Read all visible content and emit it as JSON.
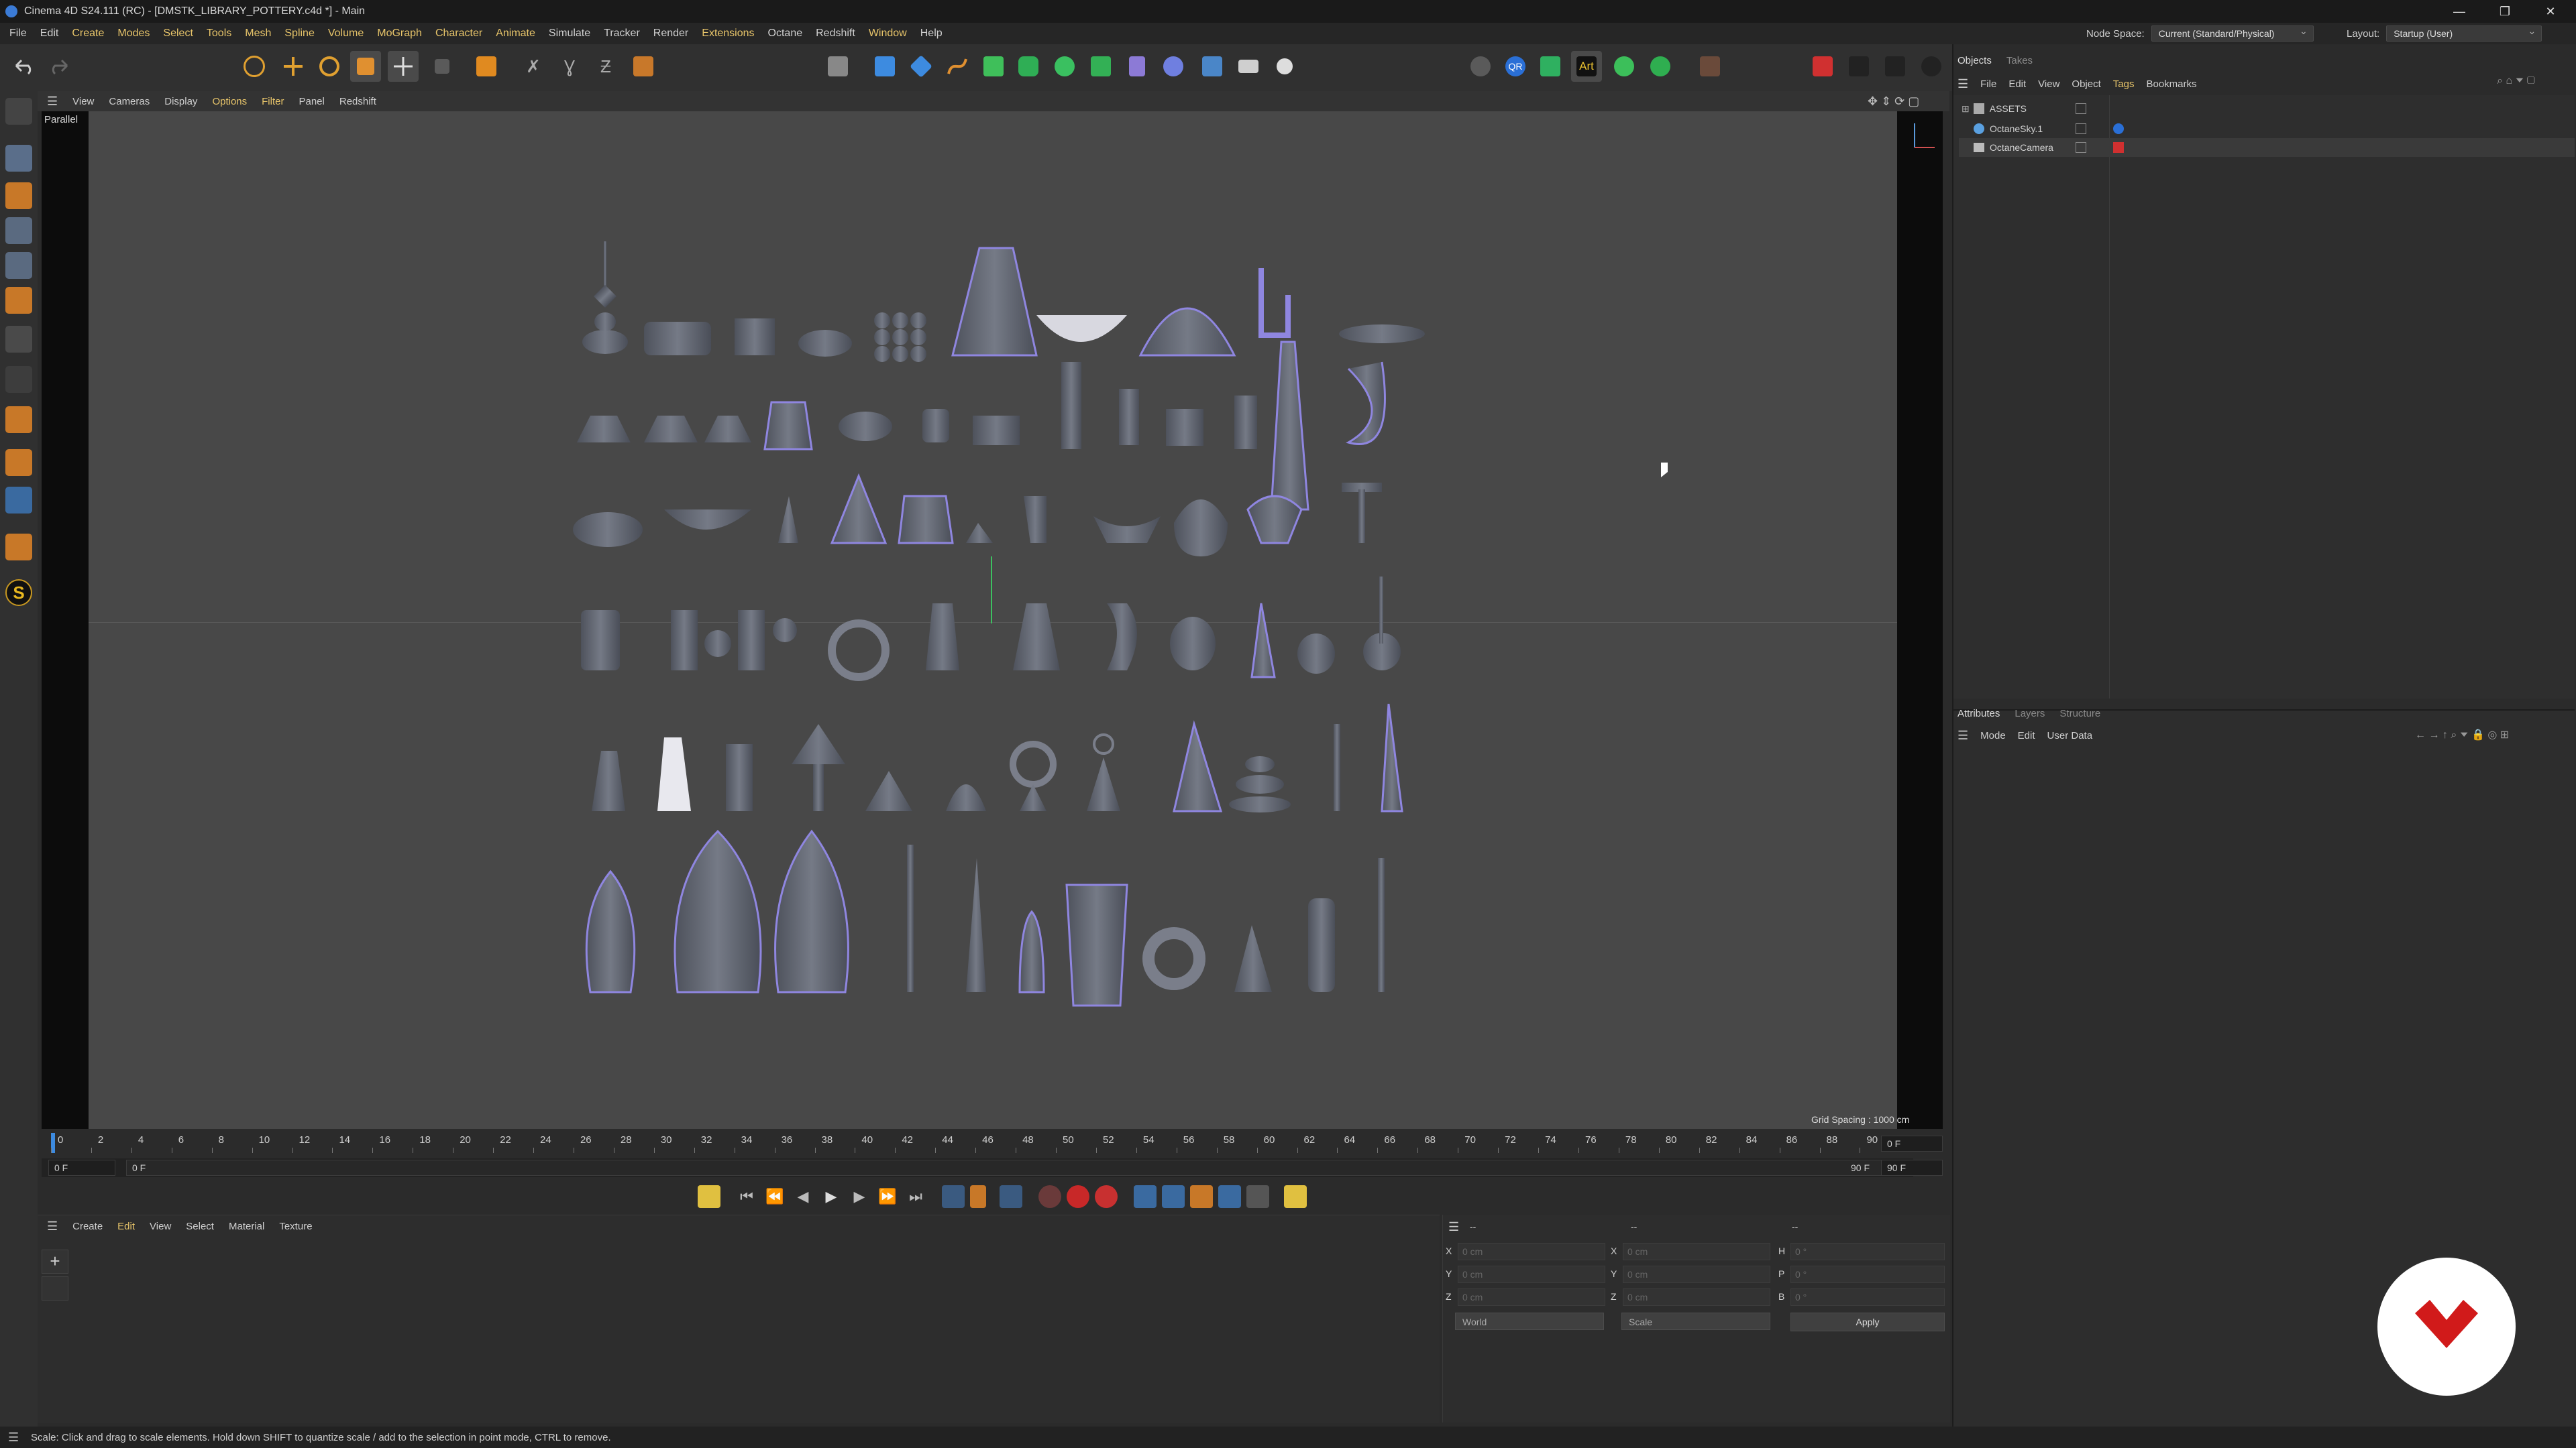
{
  "window": {
    "title": "Cinema 4D S24.111 (RC) - [DMSTK_LIBRARY_POTTERY.c4d *] - Main",
    "min": "—",
    "max": "❐",
    "close": "✕"
  },
  "menu": {
    "items": [
      "File",
      "Edit",
      "Create",
      "Modes",
      "Select",
      "Tools",
      "Mesh",
      "Spline",
      "Volume",
      "MoGraph",
      "Character",
      "Animate",
      "Simulate",
      "Tracker",
      "Render",
      "Extensions",
      "Octane",
      "Redshift",
      "Window",
      "Help"
    ],
    "node_space_label": "Node Space:",
    "node_space_value": "Current (Standard/Physical)",
    "layout_label": "Layout:",
    "layout_value": "Startup (User)"
  },
  "viewport": {
    "menu": [
      "View",
      "Cameras",
      "Display",
      "Options",
      "Filter",
      "Panel",
      "Redshift"
    ],
    "projection": "Parallel",
    "grid_spacing": "Grid Spacing : 1000 cm"
  },
  "timeline": {
    "ticks": [
      "0",
      "2",
      "4",
      "6",
      "8",
      "10",
      "12",
      "14",
      "16",
      "18",
      "20",
      "22",
      "24",
      "26",
      "28",
      "30",
      "32",
      "34",
      "36",
      "38",
      "40",
      "42",
      "44",
      "46",
      "48",
      "50",
      "52",
      "54",
      "56",
      "58",
      "60",
      "62",
      "64",
      "66",
      "68",
      "70",
      "72",
      "74",
      "76",
      "78",
      "80",
      "82",
      "84",
      "86",
      "88",
      "90"
    ],
    "current_frame": "0 F",
    "start_frame": "0 F",
    "start_inner": "0 F",
    "end_inner": "90 F",
    "end_frame": "90 F"
  },
  "material_manager": {
    "menu": [
      "Create",
      "Edit",
      "View",
      "Select",
      "Material",
      "Texture"
    ]
  },
  "coordinates": {
    "headers": [
      "--",
      "--",
      "--"
    ],
    "rows": [
      {
        "a": "X",
        "av": "0 cm",
        "b": "X",
        "bv": "0 cm",
        "c": "H",
        "cv": "0 °"
      },
      {
        "a": "Y",
        "av": "0 cm",
        "b": "Y",
        "bv": "0 cm",
        "c": "P",
        "cv": "0 °"
      },
      {
        "a": "Z",
        "av": "0 cm",
        "b": "Z",
        "bv": "0 cm",
        "c": "B",
        "cv": "0 °"
      }
    ],
    "space": "World",
    "mode": "Scale",
    "apply": "Apply"
  },
  "objects_panel": {
    "tabs": [
      "Objects",
      "Takes"
    ],
    "menu": [
      "File",
      "Edit",
      "View",
      "Object",
      "Tags",
      "Bookmarks"
    ],
    "items": [
      "ASSETS",
      "OctaneSky.1",
      "OctaneCamera"
    ]
  },
  "attributes_panel": {
    "tabs": [
      "Attributes",
      "Layers",
      "Structure"
    ],
    "menu": [
      "Mode",
      "Edit",
      "User Data"
    ]
  },
  "status": {
    "text": "Scale: Click and drag to scale elements. Hold down SHIFT to quantize scale / add to the selection in point mode, CTRL to remove."
  },
  "colors": {
    "accent": "#e8c56a",
    "viewport_bg": "#484848",
    "object_fill": "#6a6e78",
    "selection_outline": "#8f86e0",
    "badge_red": "#d11a1a"
  }
}
